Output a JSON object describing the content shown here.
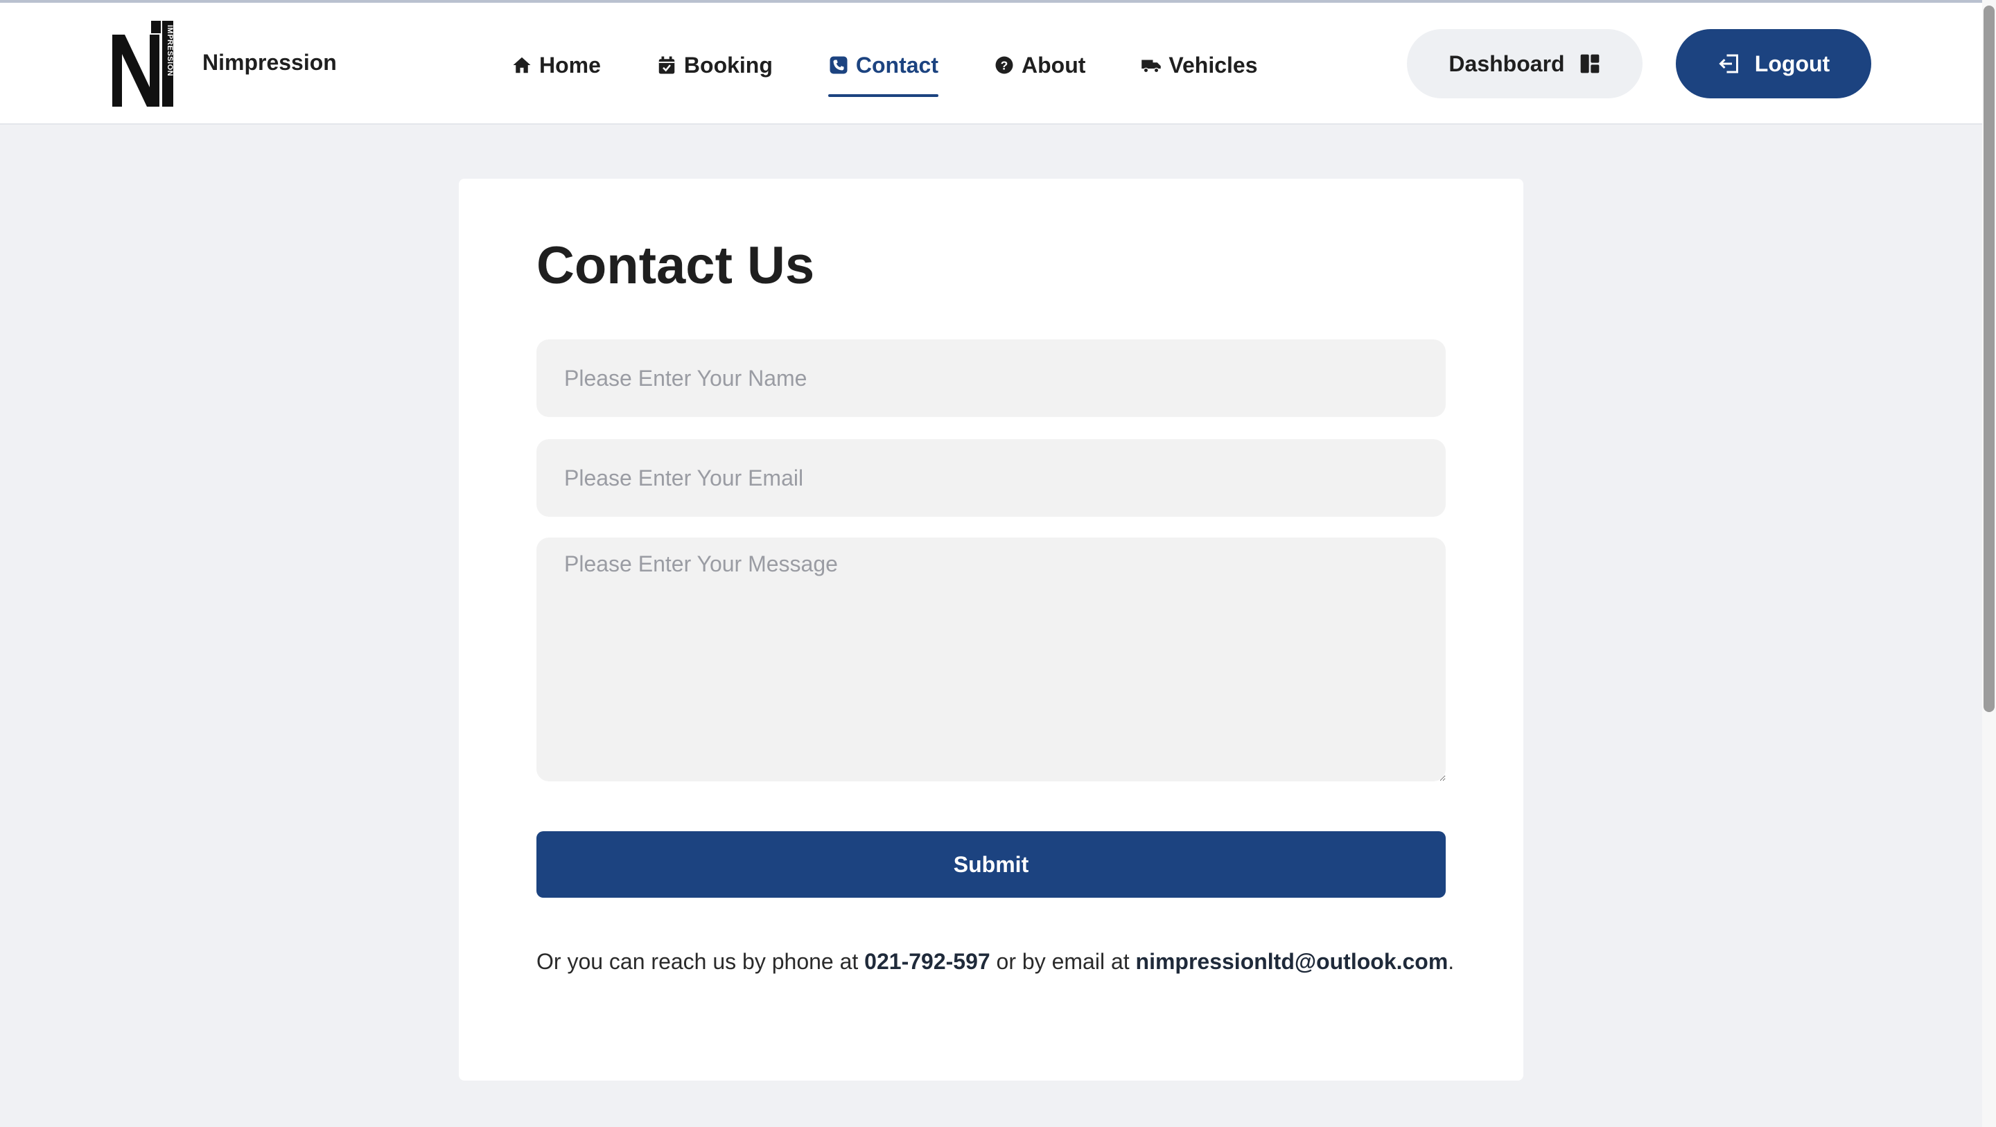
{
  "brand": {
    "name": "Nimpression",
    "logo_letters": "NI",
    "logo_vertical_text": "IMPRESSION"
  },
  "nav": {
    "items": [
      {
        "label": "Home",
        "icon": "home-icon"
      },
      {
        "label": "Booking",
        "icon": "calendar-check-icon"
      },
      {
        "label": "Contact",
        "icon": "phone-icon",
        "active": true
      },
      {
        "label": "About",
        "icon": "question-circle-icon"
      },
      {
        "label": "Vehicles",
        "icon": "truck-icon"
      }
    ]
  },
  "header_buttons": {
    "dashboard": {
      "label": "Dashboard",
      "icon": "dashboard-icon"
    },
    "logout": {
      "label": "Logout",
      "icon": "logout-icon"
    }
  },
  "form": {
    "title": "Contact Us",
    "name_placeholder": "Please Enter Your Name",
    "email_placeholder": "Please Enter Your Email",
    "message_placeholder": "Please Enter Your Message",
    "submit_label": "Submit"
  },
  "contact_info": {
    "prefix": "Or you can reach us by phone at ",
    "phone": "021-792-597",
    "middle": " or by email at ",
    "email": "nimpressionltd@outlook.com",
    "suffix": "."
  },
  "colors": {
    "primary": "#1c4380",
    "background": "#f0f1f4",
    "input_bg": "#f2f2f2"
  }
}
